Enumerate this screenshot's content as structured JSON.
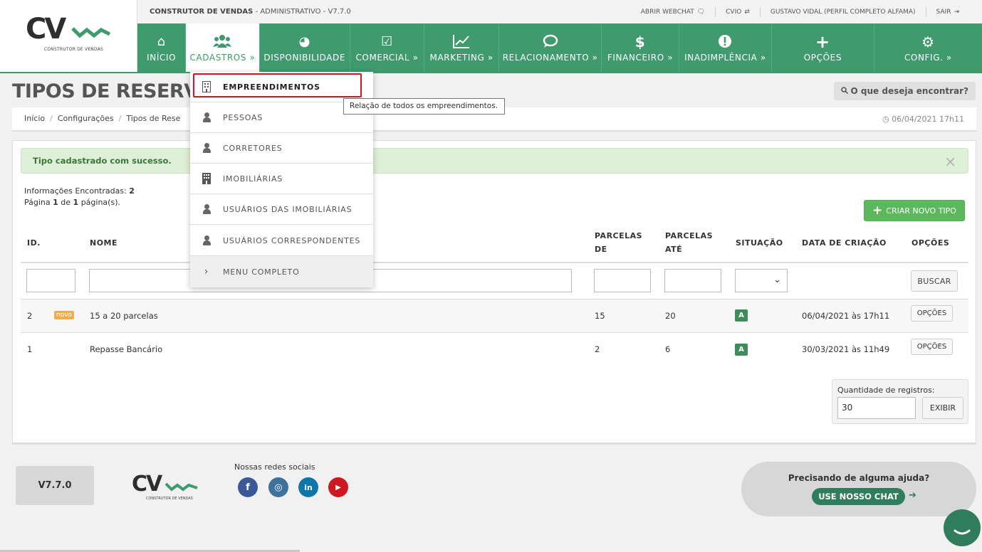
{
  "header": {
    "system_name": "CONSTRUTOR DE VENDAS",
    "system_suffix": " - ADMINISTRATIVO - V7.7.0",
    "logo_text": "CV",
    "logo_subtitle": "CONSTRUTOR DE VENDAS",
    "top_links": [
      {
        "label": "ABRIR WEBCHAT",
        "icon": "chat-icon"
      },
      {
        "label": "CVIO",
        "icon": "exchange-icon"
      },
      {
        "label": "GUSTAVO VIDAL (PERFIL COMPLETO ALFAMA)",
        "icon": ""
      },
      {
        "label": "SAIR",
        "icon": "sign-out-icon"
      }
    ]
  },
  "nav": {
    "items": [
      {
        "label": "INÍCIO",
        "icon": "home-icon",
        "glyph": "⌂"
      },
      {
        "label": "CADASTROS »",
        "icon": "users-icon",
        "glyph": "👥"
      },
      {
        "label": "DISPONIBILIDADE",
        "icon": "dashboard-icon",
        "glyph": "◕"
      },
      {
        "label": "COMERCIAL »",
        "icon": "check-square-icon",
        "glyph": "☑"
      },
      {
        "label": "MARKETING »",
        "icon": "line-chart-icon",
        "glyph": "📈"
      },
      {
        "label": "RELACIONAMENTO »",
        "icon": "comments-icon",
        "glyph": "💬"
      },
      {
        "label": "FINANCEIRO »",
        "icon": "dollar-icon",
        "glyph": "$"
      },
      {
        "label": "INADIMPLÊNCIA »",
        "icon": "exclamation-icon",
        "glyph": "!"
      },
      {
        "label": "OPÇÕES",
        "icon": "plus-icon",
        "glyph": "+"
      },
      {
        "label": "CONFIG. »",
        "icon": "gear-icon",
        "glyph": "⚙"
      }
    ]
  },
  "page": {
    "title": "TIPOS DE RESERVA",
    "search_label": "O que deseja encontrar?",
    "breadcrumb": [
      "Início",
      "Configurações",
      "Tipos de Rese"
    ],
    "datetime": "06/04/2021 17h11"
  },
  "alert": {
    "message": "Tipo cadastrado com sucesso.",
    "close": "×"
  },
  "info": {
    "found_label": "Informações Encontradas:",
    "found_count": "2",
    "page_prefix": "Página",
    "page_current": "1",
    "page_mid": "de",
    "page_total": "1",
    "page_suffix": "página(s)."
  },
  "create_button": "CRIAR NOVO TIPO",
  "table": {
    "headers": {
      "id": "ID.",
      "nome": "NOME",
      "parcelas_de_1": "PARCELAS",
      "parcelas_de_2": "DE",
      "parcelas_ate_1": "PARCELAS",
      "parcelas_ate_2": "ATÉ",
      "situacao": "SITUAÇÃO",
      "data": "DATA DE CRIAÇÃO",
      "opcoes": "OPÇÕES"
    },
    "search_button": "BUSCAR",
    "rows": [
      {
        "id": "2",
        "badge": "novo",
        "nome": "15 a 20 parcelas",
        "de": "15",
        "ate": "20",
        "situacao": "A",
        "data": "06/04/2021 às 17h11",
        "opcoes": "OPÇÕES"
      },
      {
        "id": "1",
        "badge": "",
        "nome": "Repasse Bancário",
        "de": "2",
        "ate": "6",
        "situacao": "A",
        "data": "30/03/2021 às 11h49",
        "opcoes": "OPÇÕES"
      }
    ]
  },
  "quantity": {
    "label": "Quantidade de registros:",
    "value": "30",
    "button": "EXIBIR"
  },
  "dropdown": {
    "items": [
      {
        "label": "EMPREENDIMENTOS",
        "icon": "building-icon"
      },
      {
        "label": "PESSOAS",
        "icon": "user-icon"
      },
      {
        "label": "CORRETORES",
        "icon": "user-icon"
      },
      {
        "label": "IMOBILIÁRIAS",
        "icon": "building-icon"
      },
      {
        "label": "USUÁRIOS DAS IMOBILIÁRIAS",
        "icon": "user-icon"
      },
      {
        "label": "USUÁRIOS CORRESPONDENTES",
        "icon": "user-icon"
      },
      {
        "label": "MENU COMPLETO",
        "icon": "chevron-right-icon"
      }
    ],
    "tooltip": "Relação de todos os empreendimentos."
  },
  "footer": {
    "version": "V7.7.0",
    "social_label": "Nossas redes sociais",
    "social": [
      {
        "name": "facebook-icon",
        "glyph": "f",
        "color": "#3b5998"
      },
      {
        "name": "instagram-icon",
        "glyph": "◎",
        "color": "#3f729b"
      },
      {
        "name": "linkedin-icon",
        "glyph": "in",
        "color": "#0e76a8"
      },
      {
        "name": "youtube-icon",
        "glyph": "▶",
        "color": "#cc181e"
      }
    ],
    "help_question": "Precisando de alguma ajuda?",
    "chat_button": "USE NOSSO CHAT"
  },
  "colors": {
    "brand_green": "#3f9a6e",
    "success": "#5cb85c",
    "highlight_red": "#d9141b"
  }
}
